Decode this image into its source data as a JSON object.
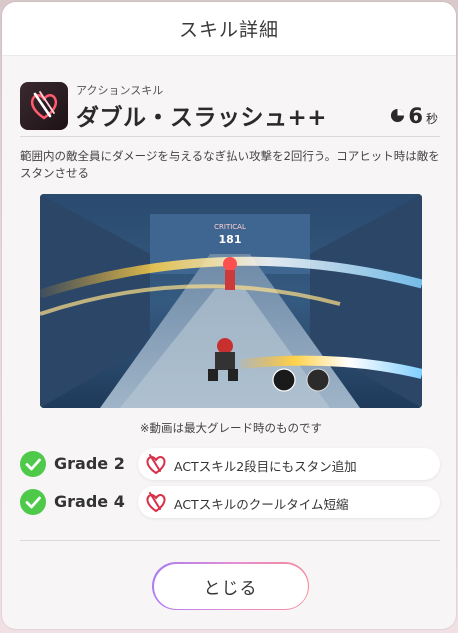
{
  "modal": {
    "title": "スキル詳細"
  },
  "skill": {
    "type": "アクションスキル",
    "name": "ダブル・スラッシュ++",
    "cooldown_value": "6",
    "cooldown_unit": "秒",
    "icon": "double-slash-skill-icon",
    "description": "範囲内の敵全員にダメージを与えるなぎ払い攻撃を2回行う。コアヒット時は敵をスタンさせる"
  },
  "video": {
    "critical_label": "CRITICAL",
    "damage_value": "181",
    "note": "※動画は最大グレード時のものです"
  },
  "grades": [
    {
      "label": "Grade 2",
      "text": "ACTスキル2段目にもスタン追加",
      "icon": "act-skill-icon"
    },
    {
      "label": "Grade 4",
      "text": "ACTスキルのクールタイム短縮",
      "icon": "act-skill-icon"
    }
  ],
  "buttons": {
    "close_label": "とじる"
  },
  "colors": {
    "check_green": "#4ec949",
    "skill_red": "#d9304a",
    "button_gradient_start": "#a97df3",
    "button_gradient_end": "#f58a9a"
  }
}
